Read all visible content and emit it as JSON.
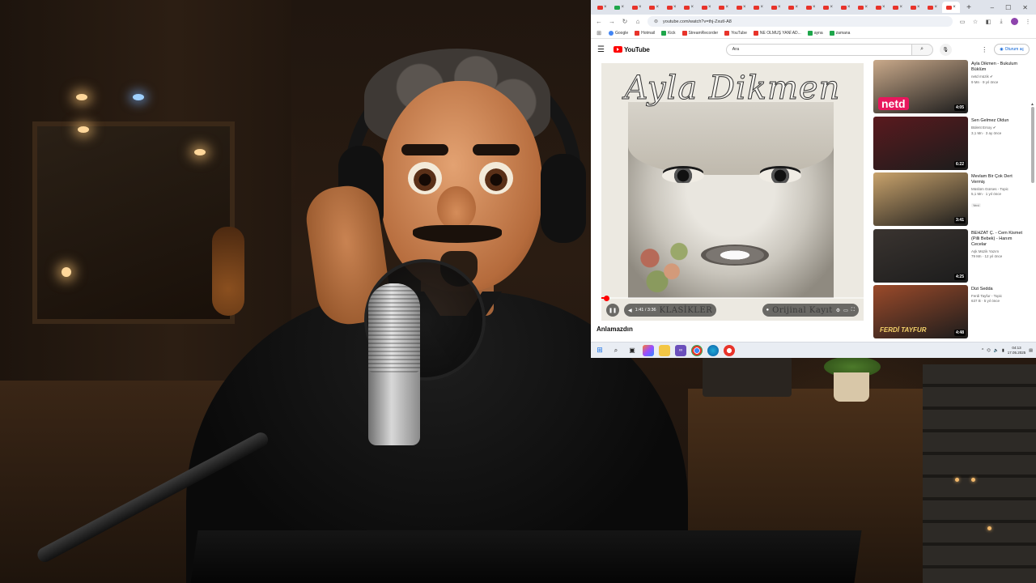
{
  "browser": {
    "tabs_count": 21,
    "new_tab": "+",
    "window_controls": {
      "minimize": "–",
      "maximize": "☐",
      "close": "✕"
    },
    "address": "youtube.com/watch?v=thj-ZxutI-A8",
    "bookmarks": [
      {
        "label": "Google",
        "kind": "b"
      },
      {
        "label": "Hotmail",
        "kind": "r"
      },
      {
        "label": "Kick",
        "kind": "g"
      },
      {
        "label": "StreamRecorder",
        "kind": "r"
      },
      {
        "label": "YouTube",
        "kind": "r"
      },
      {
        "label": "NE OLMUŞ YANİ AD...",
        "kind": "r"
      },
      {
        "label": "ayna",
        "kind": "g"
      },
      {
        "label": "zamana",
        "kind": "g"
      }
    ]
  },
  "youtube": {
    "logo": "YouTube",
    "search_value": "Ara",
    "signin": "Oturum aç",
    "player": {
      "album_title": "Ayla Dikmen",
      "watermark_left": "KLASİKLER",
      "watermark_right": "Orijinal Kayıt",
      "time": "1:41 / 3:36",
      "progress": 0.02
    },
    "caption_label": "Anlamazdın",
    "recommendations": [
      {
        "title": "Ayla Dikmen - Bukulum Büklüm",
        "channel": "netd müzik ✔",
        "views": "9 Mn · 9 yıl önce",
        "duration": "4:05",
        "thumb_text": "netd",
        "thumb_color": "#c9a98a"
      },
      {
        "title": "Sen Gelmez Oldun",
        "channel": "Bülent Ersoy ✔",
        "views": "3,1 Mn · 3 ay önce",
        "duration": "6:22",
        "thumb_text": "",
        "thumb_color": "#5a1a1e"
      },
      {
        "title": "Mevlam Bir Çok Dert Vermiş",
        "channel": "Müslüm Gürses - Topic",
        "views": "5,1 Mn · 1 yıl önce",
        "duration": "3:41",
        "thumb_text": "",
        "thumb_color": "#c9a36c",
        "badge": "Yeni"
      },
      {
        "title": "BEHZAT Ç. - Cem Kismet (Pilli Bebek) - Hanım Cecelar",
        "channel": "Aşk Müzik Yazım",
        "views": "79 Mn · 12 yıl önce",
        "duration": "4:25",
        "thumb_text": "",
        "thumb_color": "#3a3430"
      },
      {
        "title": "Dizi Sedda",
        "channel": "Ferdi Tayfur - Topic",
        "views": "637 B · 5 yıl önce",
        "duration": "4:48",
        "thumb_text": "FERDİ TAYFUR",
        "thumb_color": "#9b4a2a"
      }
    ]
  },
  "taskbar": {
    "apps": [
      "start",
      "search",
      "taskview",
      "copilot",
      "files",
      "visual-studio",
      "chrome",
      "edge",
      "recorder"
    ],
    "time": "04:13",
    "date": "17.05.2025"
  },
  "colors": {
    "yt_red": "#ff0000",
    "link_blue": "#065fd4"
  }
}
